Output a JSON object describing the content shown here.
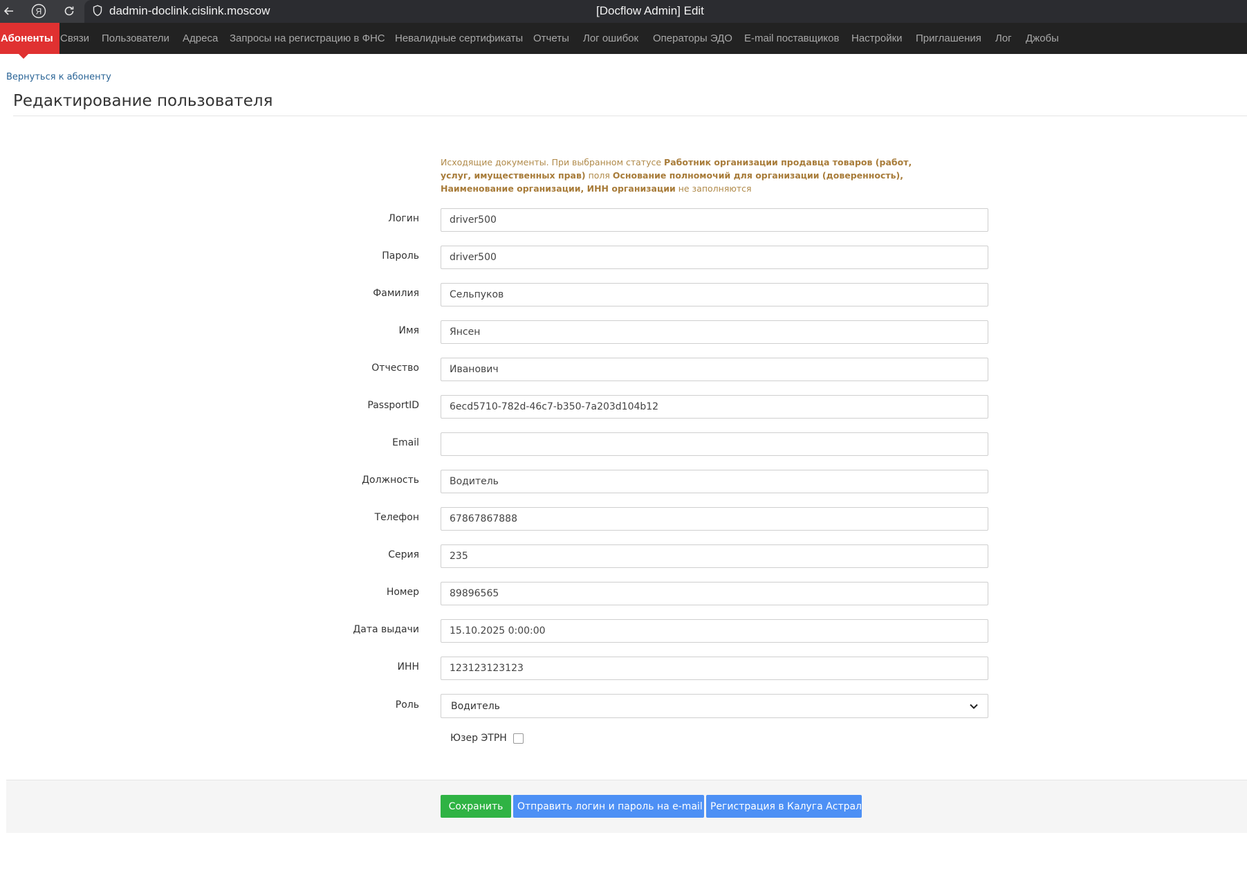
{
  "browser": {
    "url": "dadmin-doclink.cislink.moscow",
    "title": "[Docflow Admin] Edit",
    "yandex_glyph": "Я"
  },
  "nav": {
    "items": [
      {
        "label": "Абоненты"
      },
      {
        "label": "Связи"
      },
      {
        "label": "Пользователи"
      },
      {
        "label": "Адреса"
      },
      {
        "label": "Запросы на регистрацию в ФНС"
      },
      {
        "label": "Невалидные сертификаты"
      },
      {
        "label": "Отчеты"
      },
      {
        "label": "Лог ошибок"
      },
      {
        "label": "Операторы ЭДО"
      },
      {
        "label": "E-mail поставщиков"
      },
      {
        "label": "Настройки"
      },
      {
        "label": "Приглашения"
      },
      {
        "label": "Лог"
      },
      {
        "label": "Джобы"
      }
    ],
    "active_color": "#e03131"
  },
  "page": {
    "back_link": "Вернуться к абоненту",
    "title": "Редактирование пользователя"
  },
  "notice": {
    "p1": "Исходящие документы. При выбранном статусе ",
    "b1": "Работник организации продавца товаров (работ, услуг, имущественных прав)",
    "p2": " поля ",
    "b2": "Основание полномочий для организации (доверенность), Наименование организации, ИНН организации",
    "p3": " не заполняются"
  },
  "form": {
    "fields": [
      {
        "label": "Логин",
        "value": "driver500"
      },
      {
        "label": "Пароль",
        "value": "driver500"
      },
      {
        "label": "Фамилия",
        "value": "Сельпуков"
      },
      {
        "label": "Имя",
        "value": "Янсен"
      },
      {
        "label": "Отчество",
        "value": "Иванович"
      },
      {
        "label": "PassportID",
        "value": "6ecd5710-782d-46c7-b350-7a203d104b12"
      },
      {
        "label": "Email",
        "value": ""
      },
      {
        "label": "Должность",
        "value": "Водитель"
      },
      {
        "label": "Телефон",
        "value": "67867867888"
      },
      {
        "label": "Серия",
        "value": "235"
      },
      {
        "label": "Номер",
        "value": "89896565"
      },
      {
        "label": "Дата выдачи",
        "value": "15.10.2025 0:00:00"
      },
      {
        "label": "ИНН",
        "value": "123123123123"
      }
    ],
    "role": {
      "label": "Роль",
      "selected": "Водитель"
    },
    "etrn": {
      "label": "Юзер ЭТРН",
      "checked": false
    }
  },
  "buttons": {
    "save": "Сохранить",
    "send_email": "Отправить логин и пароль на e-mail",
    "register": "Регистрация в Калуга Астрал"
  },
  "colors": {
    "save_button": "#2fb344",
    "secondary_buttons": "#4d90f5",
    "navbar_bg": "#222222",
    "notice_text": "#b08a4a"
  }
}
